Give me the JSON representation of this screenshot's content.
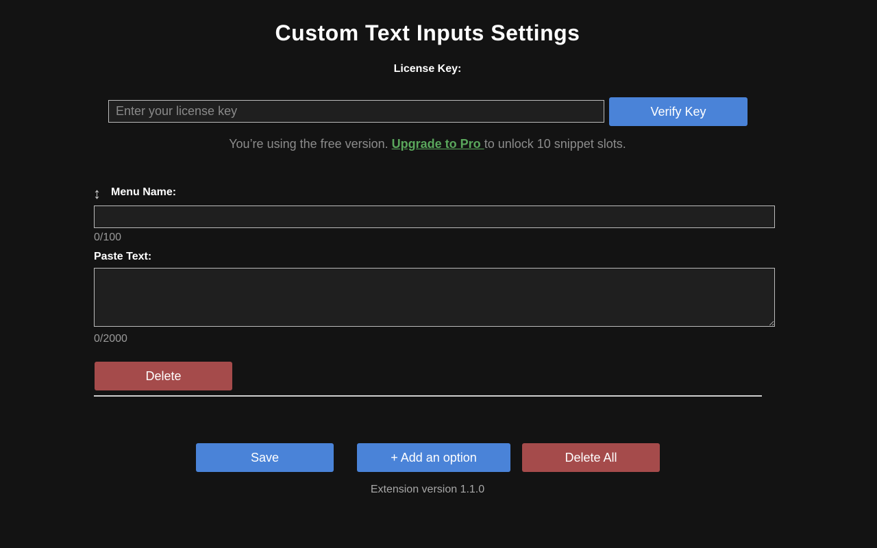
{
  "page": {
    "title": "Custom Text Inputs Settings"
  },
  "license": {
    "label": "License Key:",
    "placeholder": "Enter your license key",
    "value": "",
    "verify_label": "Verify Key",
    "notice_before": "You’re using the free version. ",
    "upgrade_link": "Upgrade to Pro ",
    "notice_after": "to unlock 10 snippet slots."
  },
  "option": {
    "drag_handle_glyph": "↕",
    "menu_name_label": "Menu Name:",
    "menu_name_value": "",
    "menu_name_counter": "0/100",
    "paste_text_label": "Paste Text:",
    "paste_text_value": "",
    "paste_text_counter": "0/2000",
    "delete_label": "Delete"
  },
  "actions": {
    "save_label": "Save",
    "add_label": "+ Add an option",
    "delete_all_label": "Delete All"
  },
  "footer": {
    "version_text": "Extension version 1.1.0"
  },
  "colors": {
    "background": "#131313",
    "primary_button": "#4a83d8",
    "danger_button": "#a54b4b",
    "link": "#5aa75c",
    "muted_text": "#8c8c8c"
  },
  "icons": {
    "drag_handle": "up-down-arrow-icon"
  }
}
